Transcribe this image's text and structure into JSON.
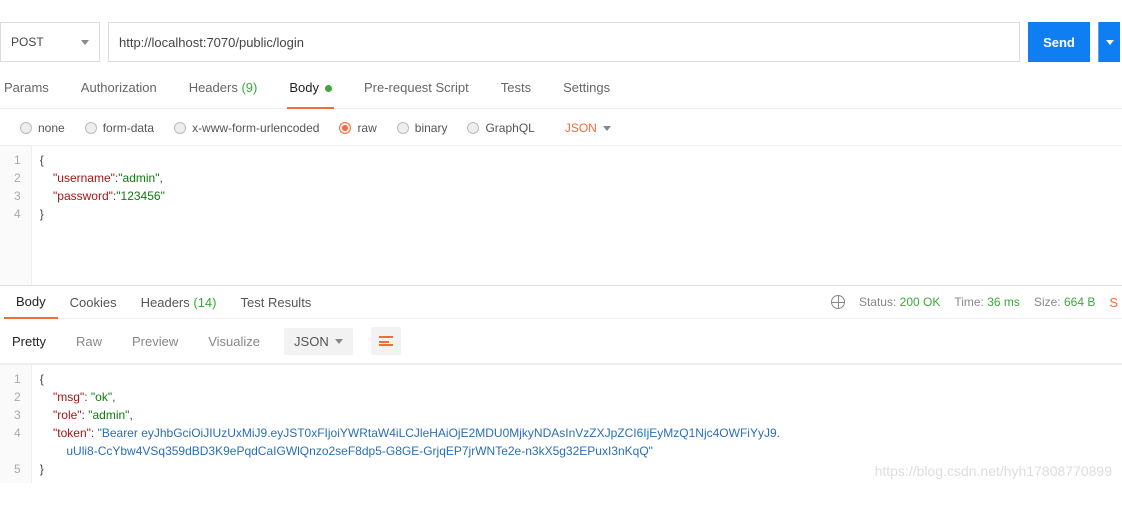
{
  "request": {
    "method": "POST",
    "url": "http://localhost:7070/public/login",
    "sendLabel": "Send"
  },
  "tabs": {
    "params": "Params",
    "authorization": "Authorization",
    "headers": "Headers",
    "headersCount": "(9)",
    "body": "Body",
    "prerequest": "Pre-request Script",
    "tests": "Tests",
    "settings": "Settings"
  },
  "bodyTypes": {
    "none": "none",
    "formdata": "form-data",
    "xwww": "x-www-form-urlencoded",
    "raw": "raw",
    "binary": "binary",
    "graphql": "GraphQL",
    "jsonLabel": "JSON"
  },
  "requestBody": {
    "lines": [
      "1",
      "2",
      "3",
      "4"
    ],
    "l1": "{",
    "k1": "\"username\"",
    "s1": "\"admin\"",
    "k2": "\"password\"",
    "s2": "\"123456\"",
    "l4": "}"
  },
  "responseTabs": {
    "body": "Body",
    "cookies": "Cookies",
    "headers": "Headers",
    "headersCount": "(14)",
    "testresults": "Test Results"
  },
  "meta": {
    "statusLabel": "Status:",
    "statusValue": "200 OK",
    "timeLabel": "Time:",
    "timeValue": "36 ms",
    "sizeLabel": "Size:",
    "sizeValue": "664 B",
    "saveCut": "S"
  },
  "respTool": {
    "pretty": "Pretty",
    "raw": "Raw",
    "preview": "Preview",
    "visualize": "Visualize",
    "format": "JSON"
  },
  "responseBody": {
    "lines": [
      "1",
      "2",
      "3",
      "4",
      "",
      "5"
    ],
    "l1": "{",
    "k1": "\"msg\"",
    "v1": "\"ok\"",
    "k2": "\"role\"",
    "v2": "\"admin\"",
    "k3": "\"token\"",
    "v3a": "\"Bearer eyJhbGciOiJIUzUxMiJ9.eyJST0xFIjoiYWRtaW4iLCJleHAiOjE2MDU0MjkyNDAsInVzZXJpZCI6IjEyMzQ1Njc4OWFiYyJ9.",
    "v3b": "uUli8-CcYbw4VSq359dBD3K9ePqdCaIGWlQnzo2seF8dp5-G8GE-GrjqEP7jrWNTe2e-n3kX5g32EPuxI3nKqQ\"",
    "l5": "}"
  },
  "watermark": "https://blog.csdn.net/hyh17808770899"
}
